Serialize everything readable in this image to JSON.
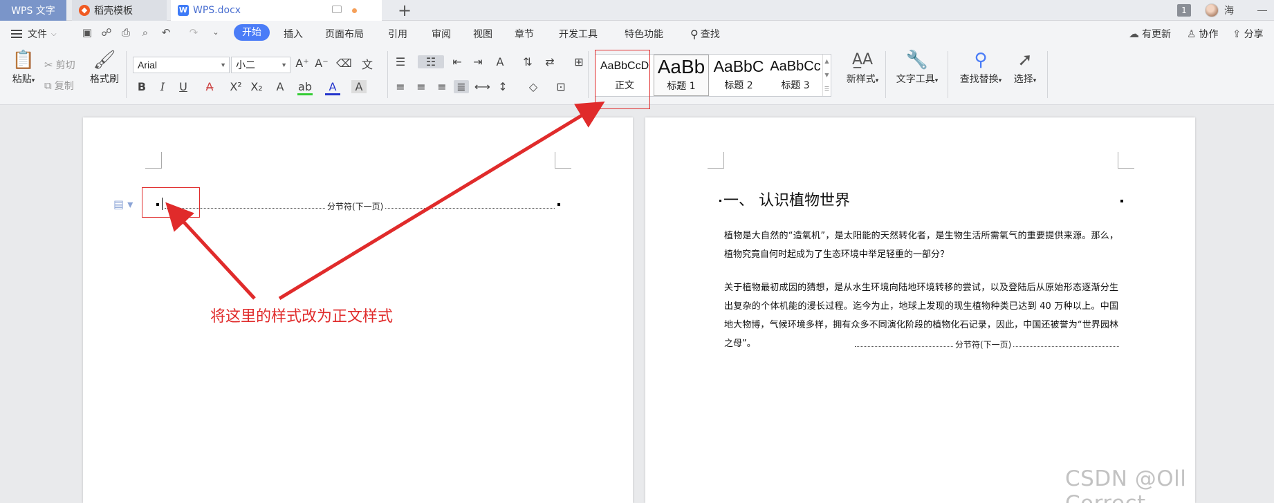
{
  "tabs": {
    "app": "WPS 文字",
    "template": "稻壳模板",
    "doc": "WPS.docx",
    "add": "+"
  },
  "titlebar": {
    "badge": "1",
    "user": "海",
    "minimize": "—"
  },
  "menu": {
    "file": "文件",
    "items": [
      "开始",
      "插入",
      "页面布局",
      "引用",
      "审阅",
      "视图",
      "章节",
      "开发工具",
      "特色功能",
      "查找"
    ],
    "right": [
      "有更新",
      "协作",
      "分享"
    ]
  },
  "ribbon": {
    "paste": "粘贴",
    "cut": "剪切",
    "copy": "复制",
    "format_painter": "格式刷",
    "font_name": "Arial",
    "font_size": "小二",
    "styles": [
      {
        "sample": "AaBbCcD",
        "name": "正文"
      },
      {
        "sample": "AaBb",
        "name": "标题 1"
      },
      {
        "sample": "AaBbC",
        "name": "标题 2"
      },
      {
        "sample": "AaBbCc",
        "name": "标题 3"
      }
    ],
    "new_style": "新样式",
    "text_tools": "文字工具",
    "find_replace": "查找替换",
    "select": "选择"
  },
  "document": {
    "section_break": "分节符(下一页)",
    "heading": "一、 认识植物世界",
    "paragraphs": [
      "植物是大自然的“造氧机”，是太阳能的天然转化者，是生物生活所需氧气的重要提供来源。那么，植物究竟自何时起成为了生态环境中举足轻重的一部分？",
      "关于植物最初成因的猜想，是从水生环境向陆地环境转移的尝试，以及登陆后从原始形态逐渐分生出复杂的个体机能的漫长过程。迄今为止，地球上发现的现生植物种类已达到 40 万种以上。中国地大物博，气候环境多样，拥有众多不同演化阶段的植物化石记录，因此，中国还被誉为“世界园林之母”。"
    ]
  },
  "annotation": {
    "callout": "将这里的样式改为正文样式",
    "color": "#e02b2b"
  },
  "watermark": "CSDN @Oll Correct",
  "colors": {
    "accent": "#4a7cf7",
    "app_tab": "#7a95c9"
  }
}
